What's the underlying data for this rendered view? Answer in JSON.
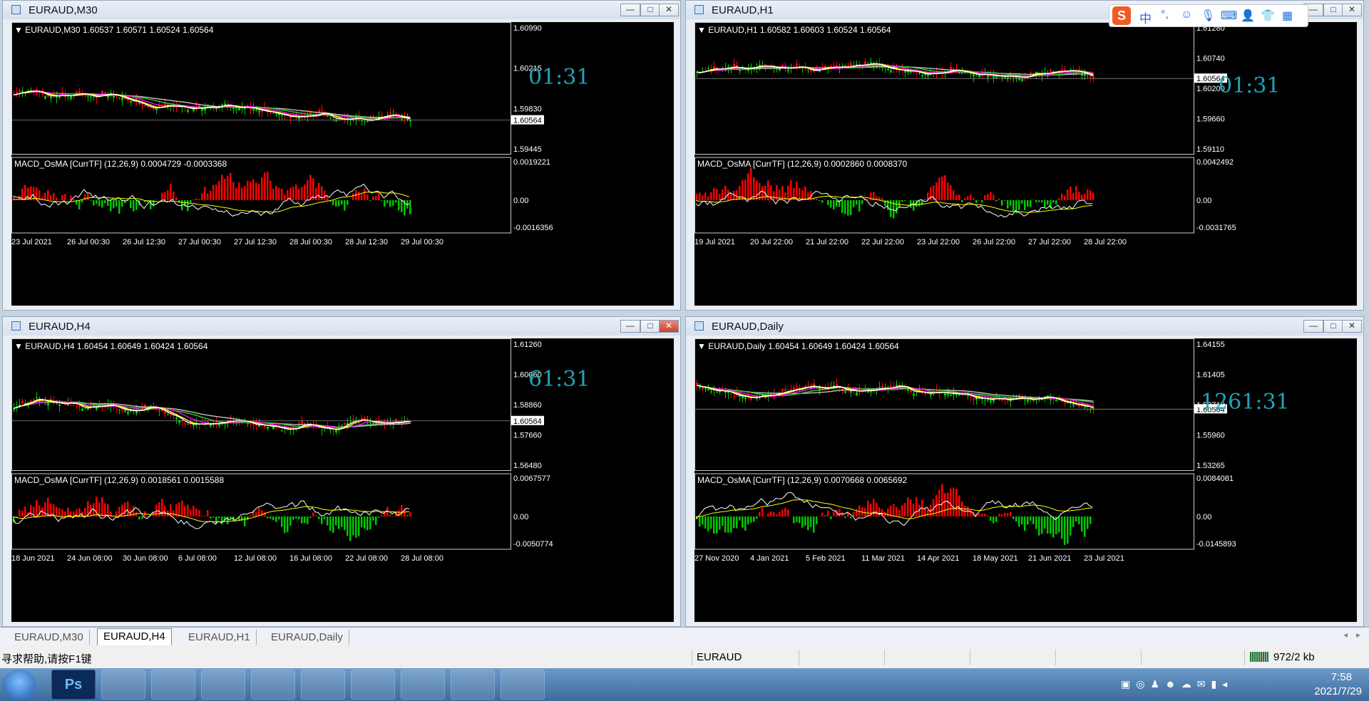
{
  "windows": [
    {
      "id": "m30",
      "title": "EURAUD,M30",
      "ohlc": "▼ EURAUD,M30  1.60537 1.60571 1.60524 1.60564",
      "clock": "01:31",
      "current_price": "1.60564",
      "price_ticks": [
        "1.60990",
        "1.60215",
        "1.59830",
        "1.59445"
      ],
      "macd_label": "MACD_OsMA [CurrTF] (12,26,9) 0.0004729 -0.0003368",
      "macd_ticks": [
        "0.0019221",
        "0.00",
        "-0.0016356"
      ],
      "date_ticks": [
        "23 Jul 2021",
        "26 Jul 00:30",
        "26 Jul 12:30",
        "27 Jul 00:30",
        "27 Jul 12:30",
        "28 Jul 00:30",
        "28 Jul 12:30",
        "29 Jul 00:30"
      ]
    },
    {
      "id": "h1",
      "title": "EURAUD,H1",
      "ohlc": "▼ EURAUD,H1  1.60582 1.60603 1.60524 1.60564",
      "clock": "01:31",
      "current_price": "1.60564",
      "price_ticks": [
        "1.61280",
        "1.60740",
        "1.60200",
        "1.59660",
        "1.59110"
      ],
      "macd_label": "MACD_OsMA [CurrTF] (12,26,9) 0.0002860 0.0008370",
      "macd_ticks": [
        "0.0042492",
        "0.00",
        "-0.0031765"
      ],
      "date_ticks": [
        "19 Jul 2021",
        "20 Jul 22:00",
        "21 Jul 22:00",
        "22 Jul 22:00",
        "23 Jul 22:00",
        "26 Jul 22:00",
        "27 Jul 22:00",
        "28 Jul 22:00"
      ]
    },
    {
      "id": "h4",
      "title": "EURAUD,H4",
      "ohlc": "▼ EURAUD,H4  1.60454 1.60649 1.60424 1.60564",
      "clock": "61:31",
      "current_price": "1.60564",
      "price_ticks": [
        "1.61260",
        "1.60060",
        "1.58860",
        "1.57660",
        "1.56480"
      ],
      "macd_label": "MACD_OsMA [CurrTF] (12,26,9) 0.0018561 0.0015588",
      "macd_ticks": [
        "0.0067577",
        "0.00",
        "-0.0050774"
      ],
      "date_ticks": [
        "18 Jun 2021",
        "24 Jun 08:00",
        "30 Jun 08:00",
        "6 Jul 08:00",
        "12 Jul 08:00",
        "16 Jul 08:00",
        "22 Jul 08:00",
        "28 Jul 08:00"
      ]
    },
    {
      "id": "d1",
      "title": "EURAUD,Daily",
      "ohlc": "▼ EURAUD,Daily  1.60454 1.60649 1.60424 1.60564",
      "clock": "1261:31",
      "current_price": "1.60564",
      "price_ticks": [
        "1.64155",
        "1.61405",
        "1.58710",
        "1.55960",
        "1.53265"
      ],
      "macd_label": "MACD_OsMA [CurrTF] (12,26,9) 0.0070668 0.0065692",
      "macd_ticks": [
        "0.0084081",
        "0.00",
        "-0.0145893"
      ],
      "date_ticks": [
        "27 Nov 2020",
        "4 Jan 2021",
        "5 Feb 2021",
        "11 Mar 2021",
        "14 Apr 2021",
        "18 May 2021",
        "21 Jun 2021",
        "23 Jul 2021"
      ]
    }
  ],
  "tabs": [
    "EURAUD,M30",
    "EURAUD,H4",
    "EURAUD,H1",
    "EURAUD,Daily"
  ],
  "active_tab": "EURAUD,H4",
  "status": {
    "help": "寻求帮助,请按F1键",
    "symbol": "EURAUD",
    "traffic": "972/2 kb"
  },
  "clock": {
    "time": "7:58",
    "date": "2021/7/29"
  },
  "ime": {
    "lang": "中"
  },
  "colors": {
    "bg": "#000000",
    "bull": "#00c800",
    "bear": "#ff0000",
    "ma_fast": "#ffffff",
    "ma_yellow": "#ffff00",
    "ma_magenta": "#ff00ff",
    "ma_green": "#32cd32",
    "ma_gray": "#c0c0c0",
    "clock": "#1fa3b5",
    "macd_pos": "#ff0000",
    "macd_neg": "#00c800"
  }
}
